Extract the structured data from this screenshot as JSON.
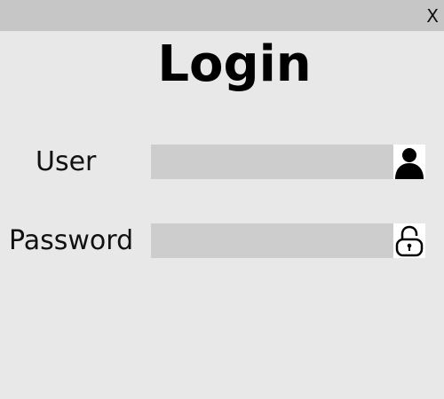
{
  "window": {
    "close_label": "X",
    "title": "Login"
  },
  "form": {
    "user": {
      "label": "User",
      "value": "",
      "icon": "user-icon"
    },
    "password": {
      "label": "Password",
      "value": "",
      "icon": "lock-icon"
    }
  },
  "colors": {
    "background": "#e8e8e8",
    "titlebar": "#c6c6c6",
    "field": "#cdcdcd",
    "icon_bg": "#ffffff"
  }
}
